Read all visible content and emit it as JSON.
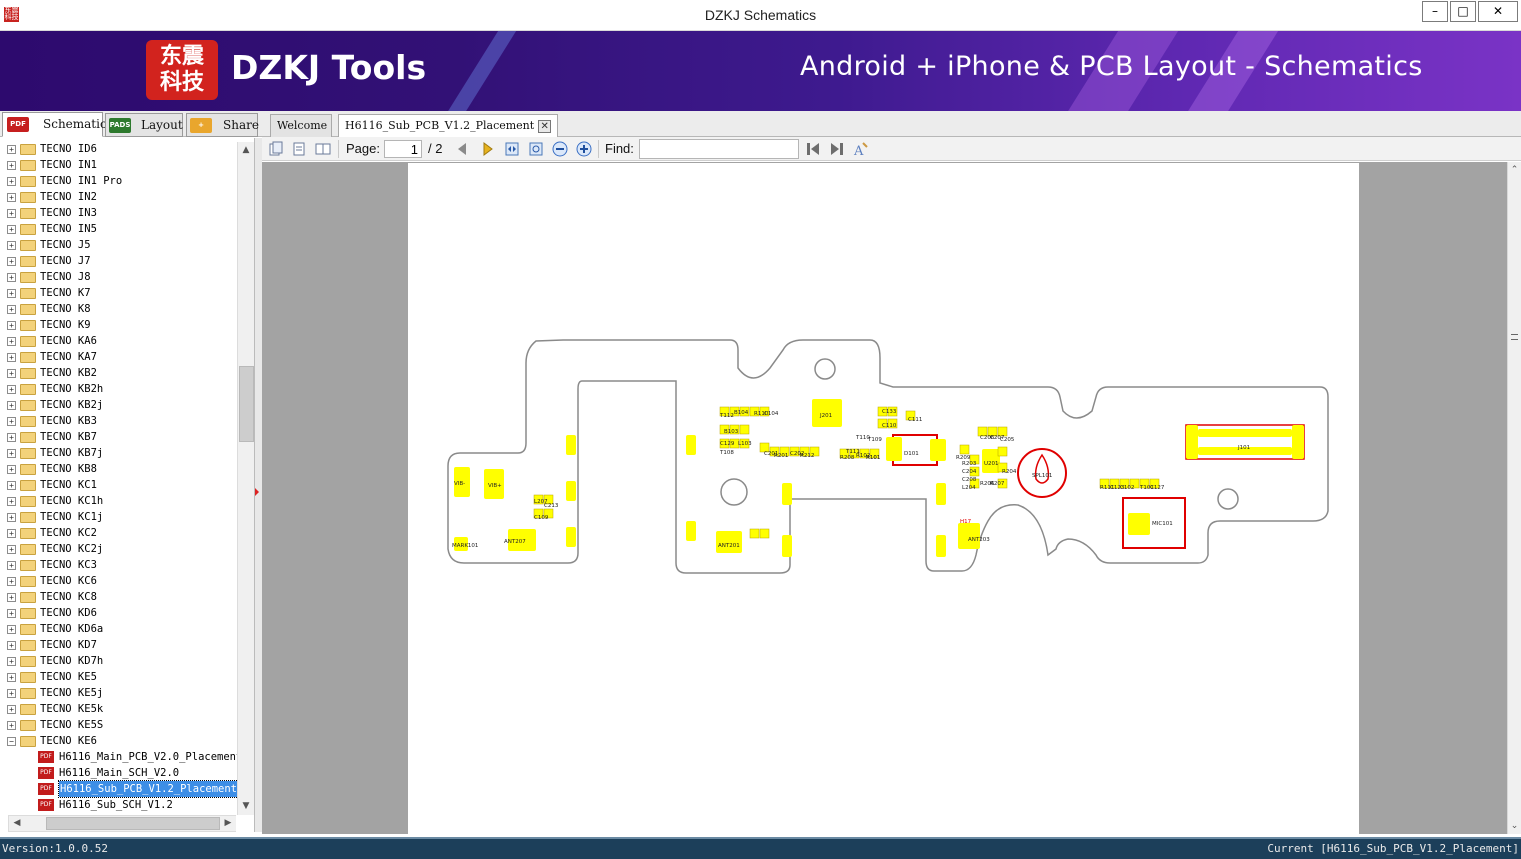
{
  "window": {
    "title": "DZKJ Schematics",
    "minimize": "–",
    "maximize": "□",
    "close": "✕"
  },
  "banner": {
    "logo_line1": "东震",
    "logo_line2": "科技",
    "brand": "DZKJ Tools",
    "tagline": "Android + iPhone & PCB Layout - Schematics"
  },
  "left_tabs": [
    {
      "icon": "PDF",
      "label": "Schematic"
    },
    {
      "icon": "PADS",
      "label": "Layout"
    },
    {
      "icon": "+",
      "label": "Share"
    }
  ],
  "doc_tabs": {
    "welcome": "Welcome",
    "active": "H6116_Sub_PCB_V1.2_Placement",
    "close": "✕"
  },
  "tree": {
    "folders": [
      "TECNO ID6",
      "TECNO IN1",
      "TECNO IN1 Pro",
      "TECNO IN2",
      "TECNO IN3",
      "TECNO IN5",
      "TECNO J5",
      "TECNO J7",
      "TECNO J8",
      "TECNO K7",
      "TECNO K8",
      "TECNO K9",
      "TECNO KA6",
      "TECNO KA7",
      "TECNO KB2",
      "TECNO KB2h",
      "TECNO KB2j",
      "TECNO KB3",
      "TECNO KB7",
      "TECNO KB7j",
      "TECNO KB8",
      "TECNO KC1",
      "TECNO KC1h",
      "TECNO KC1j",
      "TECNO KC2",
      "TECNO KC2j",
      "TECNO KC3",
      "TECNO KC6",
      "TECNO KC8",
      "TECNO KD6",
      "TECNO KD6a",
      "TECNO KD7",
      "TECNO KD7h",
      "TECNO KE5",
      "TECNO KE5j",
      "TECNO KE5k",
      "TECNO KE5S",
      "TECNO KE6"
    ],
    "files": [
      "H6116_Main_PCB_V2.0_Placement",
      "H6116_Main_SCH_V2.0",
      "H6116_Sub_PCB_V1.2_Placement",
      "H6116_Sub_SCH_V1.2"
    ],
    "selected_file": "H6116_Sub_PCB_V1.2_Placement",
    "file_icon": "PDF"
  },
  "toolbar": {
    "page_label": "Page:",
    "page_value": "1",
    "page_total": "/ 2",
    "find_label": "Find:",
    "find_value": ""
  },
  "pcb": {
    "labels": [
      "VIB-",
      "VIB+",
      "MARK101",
      "ANT207",
      "L207",
      "C213",
      "C109",
      "T112",
      "B104",
      "R110",
      "C104",
      "B103",
      "C129",
      "L103",
      "T108",
      "C201",
      "R201",
      "C202",
      "R212",
      "J201",
      "C133",
      "C110",
      "C111",
      "T110",
      "T111",
      "T109",
      "R102",
      "R101",
      "R208",
      "D101",
      "R209",
      "R203",
      "C204",
      "C208",
      "L204",
      "C206",
      "C207",
      "C205",
      "R206",
      "R207",
      "R204",
      "U201",
      "SPL101",
      "ANT201",
      "ANT203",
      "H17",
      "J101",
      "R111",
      "C123",
      "C102",
      "R101",
      "T101",
      "C127",
      "MIC101"
    ],
    "outline_color": "#8a8a8a",
    "pad_color": "#ffff00",
    "mark_color": "#e00000"
  },
  "status": {
    "version": "Version:1.0.0.52",
    "current": "Current [H6116_Sub_PCB_V1.2_Placement]"
  }
}
